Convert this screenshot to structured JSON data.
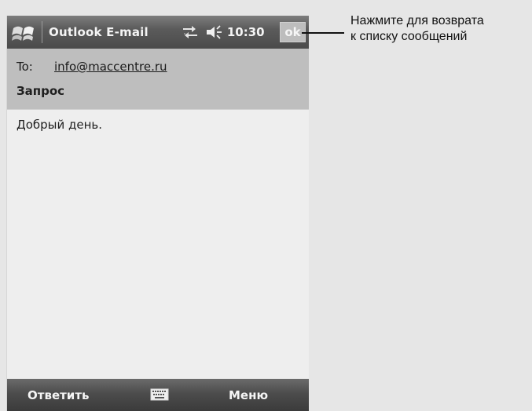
{
  "device": {
    "title_bar": {
      "icons": {
        "start": "windows-flag-icon",
        "sync": "sync-arrows-icon",
        "volume": "speaker-icon"
      },
      "title": "Outlook E-mail",
      "time": "10:30",
      "ok_label": "ok"
    },
    "message": {
      "to_label": "To:",
      "to_address": "info@maccentre.ru",
      "subject": "Запрос",
      "body": "Добрый день."
    },
    "softkeys": {
      "left": "Ответить",
      "input_icon": "keyboard-icon",
      "right": "Меню"
    }
  },
  "callout": {
    "line1": "Нажмите для возврата",
    "line2": "к списку сообщений"
  },
  "colors": {
    "title_bar": "#4b4b4b",
    "header": "#bebebe",
    "body": "#eeeeee",
    "softkey_bar": "#3b3b3b",
    "ok_button": "#bdbdbd"
  }
}
